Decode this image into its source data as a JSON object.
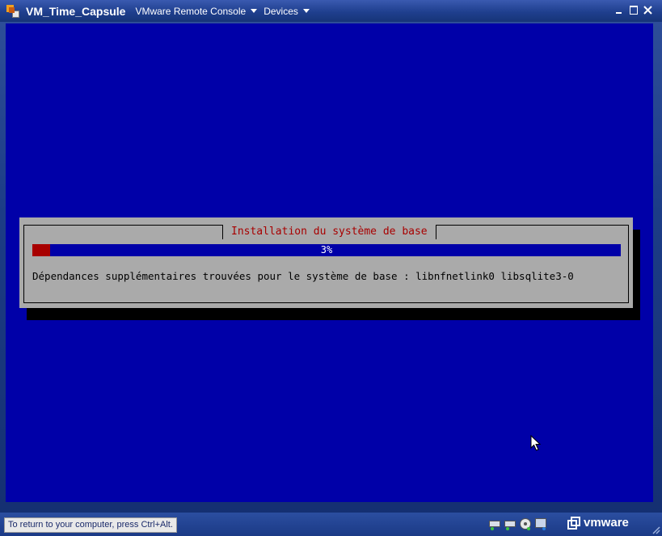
{
  "window": {
    "title": "VM_Time_Capsule",
    "menus": [
      {
        "label": "VMware Remote Console"
      },
      {
        "label": "Devices"
      }
    ],
    "buttons": [
      "minimize",
      "maximize",
      "close"
    ]
  },
  "dialog": {
    "title": "Installation du système de base",
    "progress": {
      "percent": 3,
      "label": "3%"
    },
    "message": "Dépendances supplémentaires trouvées pour le système de base : libnfnetlink0 libsqlite3-0"
  },
  "statusbar": {
    "hint": "To return to your computer, press Ctrl+Alt.",
    "devices": [
      "hard-disk-icon",
      "hard-disk-icon",
      "cd-rom-icon",
      "network-adapter-icon"
    ],
    "brand": "vmware"
  },
  "colors": {
    "console_bg": "#0000a8",
    "dialog_bg": "#aaaaaa",
    "title_red": "#a80000",
    "progress_fill": "#a80000"
  }
}
